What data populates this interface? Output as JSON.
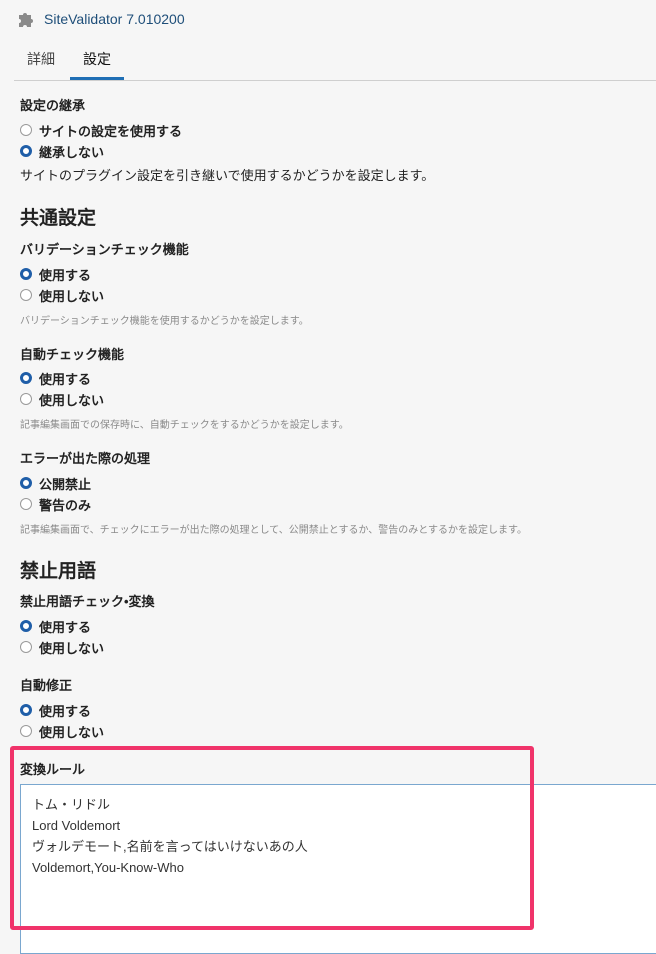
{
  "header": {
    "title": "SiteValidator 7.010200",
    "icon": "puzzle-icon"
  },
  "tabs": [
    {
      "label": "詳細",
      "active": false
    },
    {
      "label": "設定",
      "active": true
    }
  ],
  "inherit": {
    "label": "設定の継承",
    "options": [
      {
        "label": "サイトの設定を使用する",
        "checked": false
      },
      {
        "label": "継承しない",
        "checked": true
      }
    ],
    "help": "サイトのプラグイン設定を引き継いで使用するかどうかを設定します。"
  },
  "common_section": {
    "title": "共通設定"
  },
  "validation": {
    "label": "バリデーションチェック機能",
    "options": [
      {
        "label": "使用する",
        "checked": true
      },
      {
        "label": "使用しない",
        "checked": false
      }
    ],
    "help": "バリデーションチェック機能を使用するかどうかを設定します。"
  },
  "auto_check": {
    "label": "自動チェック機能",
    "options": [
      {
        "label": "使用する",
        "checked": true
      },
      {
        "label": "使用しない",
        "checked": false
      }
    ],
    "help": "記事編集画面での保存時に、自動チェックをするかどうかを設定します。"
  },
  "error_handling": {
    "label": "エラーが出た際の処理",
    "options": [
      {
        "label": "公開禁止",
        "checked": true
      },
      {
        "label": "警告のみ",
        "checked": false
      }
    ],
    "help": "記事編集画面で、チェックにエラーが出た際の処理として、公開禁止とするか、警告のみとするかを設定します。"
  },
  "forbidden_section": {
    "title": "禁止用語"
  },
  "forbidden_check": {
    "label": "禁止用語チェック•変換",
    "options": [
      {
        "label": "使用する",
        "checked": true
      },
      {
        "label": "使用しない",
        "checked": false
      }
    ]
  },
  "auto_fix": {
    "label": "自動修正",
    "options": [
      {
        "label": "使用する",
        "checked": true
      },
      {
        "label": "使用しない",
        "checked": false
      }
    ]
  },
  "conversion_rules": {
    "label": "変換ルール",
    "lines": [
      "トム・リドル",
      "Lord Voldemort",
      "ヴォルデモート,名前を言ってはいけないあの人",
      "Voldemort,You-Know-Who"
    ]
  },
  "colors": {
    "accent": "#1f5ea8",
    "highlight": "#f0336a",
    "title": "#1e4e79"
  }
}
